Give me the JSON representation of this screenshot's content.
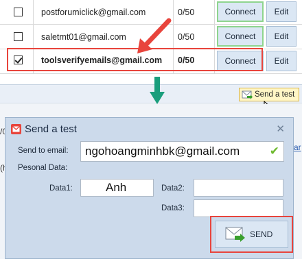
{
  "accounts": [
    {
      "email": "postforumiclick@gmail.com",
      "quota": "0/50",
      "connect": "Connect",
      "edit": "Edit",
      "checked": false
    },
    {
      "email": "saletmt01@gmail.com",
      "quota": "0/50",
      "connect": "Connect",
      "edit": "Edit",
      "checked": false
    },
    {
      "email": "toolsverifyemails@gmail.com",
      "quota": "0/50",
      "connect": "Connect",
      "edit": "Edit",
      "checked": true
    }
  ],
  "toolbar": {
    "send_test_label": "Send a test"
  },
  "background": {
    "char1": "/0",
    "char2": "(h",
    "char3": "ar"
  },
  "dialog": {
    "title": "Send a test",
    "send_to_label": "Send to email:",
    "send_to_value": "ngohoangminhbk@gmail.com",
    "personal_label": "Pesonal Data:",
    "data1_label": "Data1:",
    "data1_value": "Anh",
    "data2_label": "Data2:",
    "data2_value": "",
    "data3_label": "Data3:",
    "data3_value": "",
    "send_label": "SEND"
  },
  "colors": {
    "highlight": "#e8443c",
    "annotation_arrow_red": "#e8443c",
    "annotation_arrow_green": "#1a9e7c"
  }
}
